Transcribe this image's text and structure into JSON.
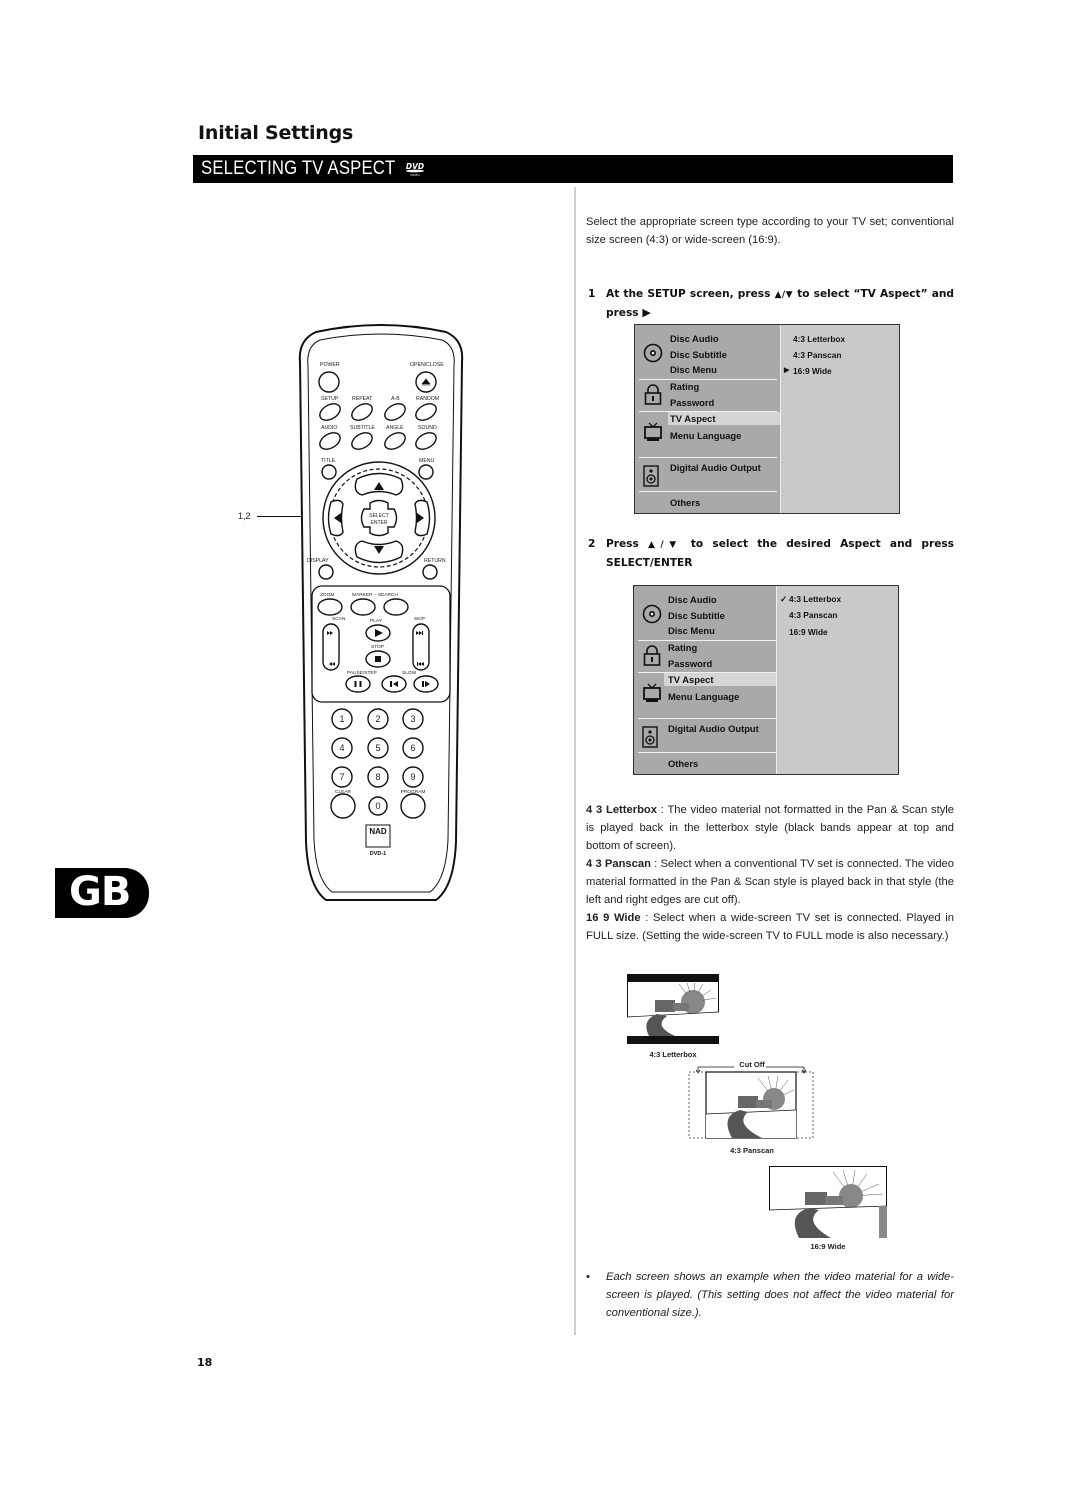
{
  "header": {
    "section_title": "Initial Settings",
    "banner_title": "SELECTING TV ASPECT",
    "banner_icon": "dvd-video-logo"
  },
  "intro_text": "Select the appropriate screen type according to your TV set; conventional size screen (4:3) or wide-screen (16:9).",
  "steps": [
    {
      "number": "1",
      "text_before": "At the SETUP screen, press",
      "arrows": "▲/▼",
      "text_after": "to select “TV Aspect” and press",
      "end_symbol": "▶"
    },
    {
      "number": "2",
      "text_before": "Press",
      "arrows": "▲/▼",
      "text_after": "to select the desired Aspect and press",
      "end_word": "SELECT/ENTER"
    }
  ],
  "setup_menu_1": {
    "items": [
      "Disc Audio",
      "Disc Subtitle",
      "Disc Menu",
      "Rating",
      "Password",
      "TV Aspect",
      "Menu Language",
      "Digital Audio Output",
      "Others"
    ],
    "highlighted": "TV Aspect",
    "options": [
      {
        "marker": "",
        "label": "4:3 Letterbox"
      },
      {
        "marker": "",
        "label": "4:3 Panscan"
      },
      {
        "marker": "▶",
        "label": "16:9 Wide"
      }
    ]
  },
  "setup_menu_2": {
    "items": [
      "Disc Audio",
      "Disc Subtitle",
      "Disc Menu",
      "Rating",
      "Password",
      "TV Aspect",
      "Menu Language",
      "Digital Audio Output",
      "Others"
    ],
    "highlighted": "TV Aspect",
    "options": [
      {
        "marker": "✓",
        "label": "4:3 Letterbox"
      },
      {
        "marker": "",
        "label": "4:3 Panscan"
      },
      {
        "marker": "",
        "label": "16:9 Wide"
      }
    ]
  },
  "descriptions": [
    {
      "term": "4 3 Letterbox",
      "text": " : The video material not formatted in the Pan & Scan style is played back in the letterbox style (black bands appear at top and bottom of screen)."
    },
    {
      "term": "4 3 Panscan",
      "text": " : Select when a conventional TV set is connected. The video material formatted in the Pan & Scan style is played back in that style (the left and right edges are cut off)."
    },
    {
      "term": "16 9 Wide",
      "text": " : Select when a wide-screen TV set is connected. Played in FULL size. (Setting the wide-screen TV to FULL mode is also necessary.)"
    }
  ],
  "illustrations": {
    "letterbox_caption": "4:3 Letterbox",
    "cutoff_label": "Cut Off",
    "panscan_caption": "4:3 Panscan",
    "wide_caption": "16:9 Wide"
  },
  "note": {
    "bullet": "•",
    "text": "Each screen shows an example when the video material for a wide-screen is played. (This setting does not affect the video material for conventional size.)."
  },
  "remote": {
    "callout": "1,2",
    "labels": {
      "power": "POWER",
      "open_close": "OPEN/CLOSE",
      "setup": "SETUP",
      "repeat": "REPEAT",
      "ab": "A-B",
      "random": "RANDOM",
      "audio": "AUDIO",
      "subtitle": "SUBTITLE",
      "angle": "ANGLE",
      "sound": "SOUND",
      "title": "TITLE",
      "menu": "MENU",
      "select": "SELECT",
      "enter": "ENTER",
      "display": "DISPLAY",
      "return": "RETURN",
      "zoom": "ZOOM",
      "marker_search": "MARKER – SEARCH",
      "scan": "SCAN",
      "play": "PLAY",
      "skip": "SKIP",
      "stop": "STOP",
      "pause_step": "PAUSE/STEP",
      "slow": "SLOW",
      "clear": "CLEAR",
      "program": "PROGRAM",
      "brand": "NAD",
      "model": "DVD-1"
    },
    "digits": [
      "1",
      "2",
      "3",
      "4",
      "5",
      "6",
      "7",
      "8",
      "9",
      "0"
    ]
  },
  "language_badge": "GB",
  "page_number": "18"
}
